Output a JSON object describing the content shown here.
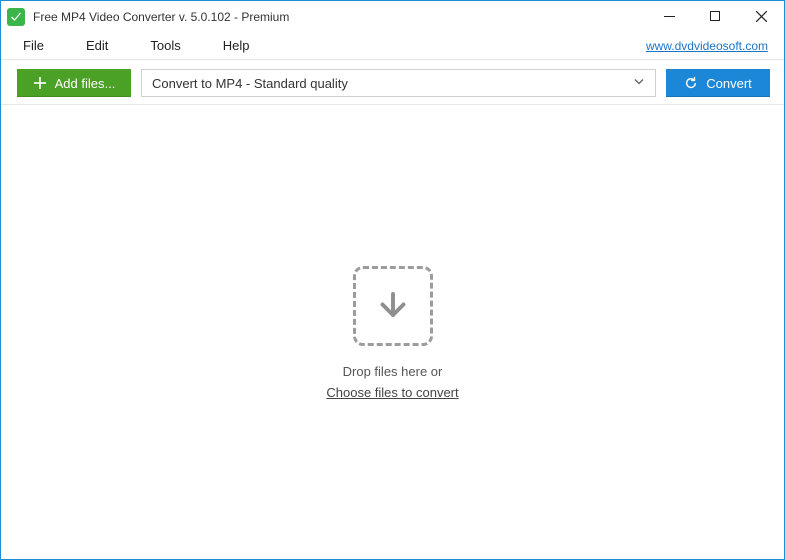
{
  "window": {
    "title": "Free MP4 Video Converter v. 5.0.102 - Premium"
  },
  "menubar": {
    "items": [
      "File",
      "Edit",
      "Tools",
      "Help"
    ],
    "site_link": "www.dvdvideosoft.com"
  },
  "toolbar": {
    "add_files_label": "Add files...",
    "preset_selected": "Convert to MP4 - Standard quality",
    "convert_label": "Convert"
  },
  "drop": {
    "hint": "Drop files here or",
    "choose_label": "Choose files to convert"
  }
}
